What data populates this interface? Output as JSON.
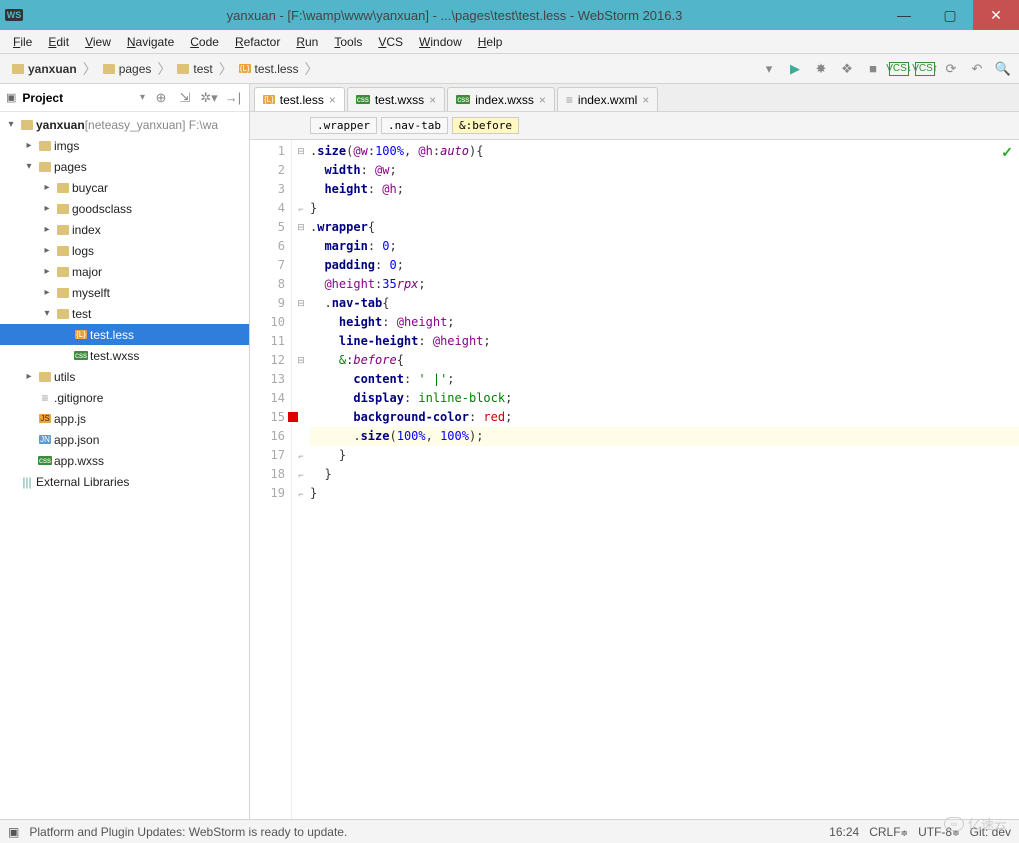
{
  "window": {
    "title": "yanxuan - [F:\\wamp\\www\\yanxuan] - ...\\pages\\test\\test.less - WebStorm 2016.3",
    "app_badge": "WS",
    "buttons": {
      "min": "—",
      "max": "▢",
      "close": "✕"
    }
  },
  "menu": [
    "File",
    "Edit",
    "View",
    "Navigate",
    "Code",
    "Refactor",
    "Run",
    "Tools",
    "VCS",
    "Window",
    "Help"
  ],
  "breadcrumbs": [
    {
      "icon": "folder",
      "label": "yanxuan",
      "bold": true
    },
    {
      "icon": "folder",
      "label": "pages"
    },
    {
      "icon": "folder",
      "label": "test"
    },
    {
      "icon": "less",
      "label": "test.less"
    }
  ],
  "sidebar": {
    "title": "Project"
  },
  "tree": [
    {
      "depth": 0,
      "tw": "▾",
      "ic": "folder",
      "label": "yanxuan",
      "hint": " [neteasy_yanxuan]  F:\\wa"
    },
    {
      "depth": 1,
      "tw": "▸",
      "ic": "folder",
      "label": "imgs"
    },
    {
      "depth": 1,
      "tw": "▾",
      "ic": "folder",
      "label": "pages"
    },
    {
      "depth": 2,
      "tw": "▸",
      "ic": "folder",
      "label": "buycar"
    },
    {
      "depth": 2,
      "tw": "▸",
      "ic": "folder",
      "label": "goodsclass"
    },
    {
      "depth": 2,
      "tw": "▸",
      "ic": "folder",
      "label": "index"
    },
    {
      "depth": 2,
      "tw": "▸",
      "ic": "folder",
      "label": "logs"
    },
    {
      "depth": 2,
      "tw": "▸",
      "ic": "folder",
      "label": "major"
    },
    {
      "depth": 2,
      "tw": "▸",
      "ic": "folder",
      "label": "myselft"
    },
    {
      "depth": 2,
      "tw": "▾",
      "ic": "folder",
      "label": "test"
    },
    {
      "depth": 3,
      "tw": "",
      "ic": "less",
      "label": "test.less",
      "sel": true
    },
    {
      "depth": 3,
      "tw": "",
      "ic": "css",
      "label": "test.wxss"
    },
    {
      "depth": 1,
      "tw": "▸",
      "ic": "folder",
      "label": "utils"
    },
    {
      "depth": 1,
      "tw": "",
      "ic": "txt",
      "label": ".gitignore"
    },
    {
      "depth": 1,
      "tw": "",
      "ic": "js",
      "label": "app.js"
    },
    {
      "depth": 1,
      "tw": "",
      "ic": "json",
      "label": "app.json"
    },
    {
      "depth": 1,
      "tw": "",
      "ic": "css",
      "label": "app.wxss"
    },
    {
      "depth": 0,
      "tw": "",
      "ic": "lib",
      "label": "External Libraries"
    }
  ],
  "tabs": [
    {
      "ic": "less",
      "label": "test.less",
      "active": true
    },
    {
      "ic": "css",
      "label": "test.wxss"
    },
    {
      "ic": "css",
      "label": "index.wxss"
    },
    {
      "ic": "txt",
      "label": "index.wxml"
    }
  ],
  "bc2": [
    {
      "t": ".wrapper"
    },
    {
      "t": ".nav-tab"
    },
    {
      "t": "&:before",
      "hl": true
    }
  ],
  "code": {
    "lines": 19,
    "cursor_line": 16,
    "red_marker_line": 15
  },
  "code_lines_raw": [
    ".size(@w:100%, @h:auto){",
    "  width: @w;",
    "  height: @h;",
    "}",
    ".wrapper{",
    "  margin: 0;",
    "  padding: 0;",
    "  @height:35rpx;",
    "  .nav-tab{",
    "    height: @height;",
    "    line-height: @height;",
    "    &:before{",
    "      content: '|';",
    "      display: inline-block;",
    "      background-color: red;",
    "      .size(100%, 100%);",
    "    }",
    "  }",
    "}"
  ],
  "status": {
    "left": "Platform and Plugin Updates: WebStorm is ready to update.",
    "pos": "16:24",
    "eol": "CRLF",
    "enc": "UTF-8",
    "git": "Git: dev",
    "watermark": "亿速云"
  }
}
